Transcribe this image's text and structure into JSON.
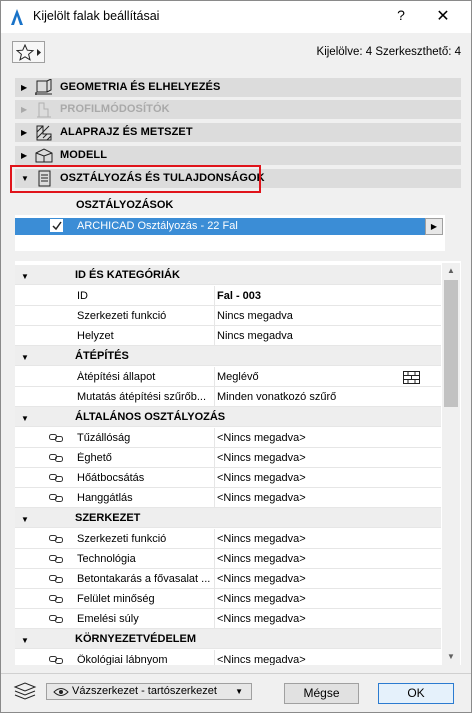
{
  "window": {
    "title": "Kijelölt falak beállításai",
    "help_label": "?",
    "close_label": "✕"
  },
  "selection_info": "Kijelölve: 4 Szerkeszthető: 4",
  "panels": [
    {
      "label": "GEOMETRIA ÉS ELHELYEZÉS",
      "icon": "geometry-icon",
      "expanded": false,
      "disabled": false
    },
    {
      "label": "PROFILMÓDOSÍTÓK",
      "icon": "profile-modifier-icon",
      "expanded": false,
      "disabled": true
    },
    {
      "label": "ALAPRAJZ ÉS METSZET",
      "icon": "floor-plan-section-icon",
      "expanded": false,
      "disabled": false
    },
    {
      "label": "MODELL",
      "icon": "model-icon",
      "expanded": false,
      "disabled": false
    },
    {
      "label": "OSZTÁLYOZÁS ÉS TULAJDONSÁGOK",
      "icon": "classification-icon",
      "expanded": true,
      "disabled": false
    }
  ],
  "classifications": {
    "header": "OSZTÁLYOZÁSOK",
    "items": [
      {
        "label": "ARCHICAD Osztályozás - 22 Fal",
        "checked": true
      }
    ]
  },
  "properties": {
    "groups": [
      {
        "name": "ID ÉS KATEGÓRIÁK",
        "rows": [
          {
            "name": "ID",
            "value": "Fal - 003",
            "value_bold": true
          },
          {
            "name": "Szerkezeti funkció",
            "value": "Nincs megadva"
          },
          {
            "name": "Helyzet",
            "value": "Nincs megadva"
          }
        ]
      },
      {
        "name": "ÁTÉPÍTÉS",
        "rows": [
          {
            "name": "Átépítési állapot",
            "value": "Meglévő",
            "icon": "brick-pattern-icon"
          },
          {
            "name": "Mutatás átépítési szűrőb...",
            "value": "Minden vonatkozó szűrő"
          }
        ]
      },
      {
        "name": "ÁLTALÁNOS OSZTÁLYOZÁS",
        "rows": [
          {
            "name": "Tűzállóság",
            "value": "<Nincs megadva>",
            "linked": true
          },
          {
            "name": "Éghető",
            "value": "<Nincs megadva>",
            "linked": true
          },
          {
            "name": "Hőátbocsátás",
            "value": "<Nincs megadva>",
            "linked": true
          },
          {
            "name": "Hanggátlás",
            "value": "<Nincs megadva>",
            "linked": true
          }
        ]
      },
      {
        "name": "SZERKEZET",
        "rows": [
          {
            "name": "Szerkezeti funkció",
            "value": "<Nincs megadva>",
            "linked": true
          },
          {
            "name": "Technológia",
            "value": "<Nincs megadva>",
            "linked": true
          },
          {
            "name": "Betontakarás a fővasalat ...",
            "value": "<Nincs megadva>",
            "linked": true
          },
          {
            "name": "Felület minőség",
            "value": "<Nincs megadva>",
            "linked": true
          },
          {
            "name": "Emelési súly",
            "value": "<Nincs megadva>",
            "linked": true
          }
        ]
      },
      {
        "name": "KÖRNYEZETVÉDELEM",
        "rows": [
          {
            "name": "Ökológiai lábnyom",
            "value": "<Nincs megadva>",
            "linked": true
          }
        ]
      }
    ]
  },
  "footer": {
    "layer": "Vázszerkezet - tartószerkezet",
    "cancel_label": "Mégse",
    "ok_label": "OK"
  },
  "colors": {
    "selection": "#3b8dd6",
    "highlight_box": "#e0141b",
    "panel_bg": "#dcdcdc"
  }
}
